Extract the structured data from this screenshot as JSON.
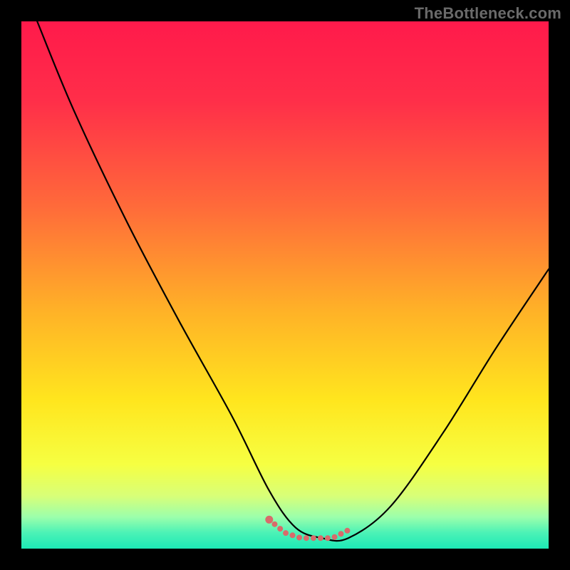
{
  "watermark": "TheBottleneck.com",
  "colors": {
    "black": "#000000",
    "curve_stroke": "#000000",
    "dotted_stroke": "#d86b6b",
    "gradient_stops": [
      {
        "offset": 0.0,
        "color": "#ff1a4b"
      },
      {
        "offset": 0.15,
        "color": "#ff2e49"
      },
      {
        "offset": 0.35,
        "color": "#ff6a3a"
      },
      {
        "offset": 0.55,
        "color": "#ffb227"
      },
      {
        "offset": 0.72,
        "color": "#ffe61e"
      },
      {
        "offset": 0.84,
        "color": "#f6ff42"
      },
      {
        "offset": 0.9,
        "color": "#d8ff78"
      },
      {
        "offset": 0.94,
        "color": "#9cffab"
      },
      {
        "offset": 0.97,
        "color": "#4bf2b6"
      },
      {
        "offset": 1.0,
        "color": "#1de9b6"
      }
    ]
  },
  "chart_data": {
    "type": "line",
    "title": "",
    "xlabel": "",
    "ylabel": "",
    "xlim": [
      0,
      100
    ],
    "ylim": [
      0,
      100
    ],
    "series": [
      {
        "name": "bottleneck-curve",
        "x": [
          3,
          10,
          20,
          30,
          40,
          47,
          52,
          57,
          62,
          70,
          80,
          90,
          100
        ],
        "values": [
          100,
          83,
          62,
          43,
          25,
          11,
          4,
          2,
          2,
          8,
          22,
          38,
          53
        ]
      }
    ],
    "dotted_segment": {
      "name": "optimal-flat-region",
      "x": [
        47,
        50,
        53,
        56,
        59,
        62
      ],
      "values": [
        5.5,
        3.0,
        2.0,
        2.0,
        2.0,
        3.5
      ]
    }
  }
}
